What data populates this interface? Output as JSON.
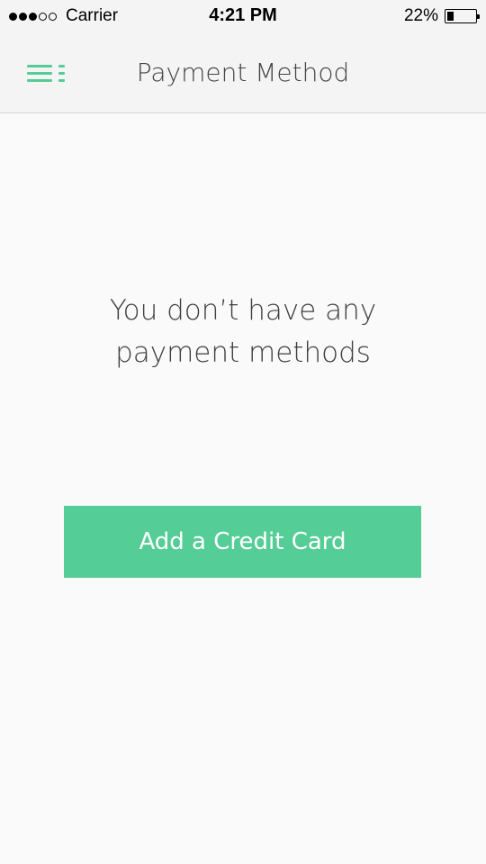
{
  "status_bar": {
    "carrier": "Carrier",
    "time": "4:21 PM",
    "battery_percent": "22%",
    "battery_level": 0.22,
    "signal_bars_filled": 3,
    "signal_bars_total": 5
  },
  "nav": {
    "title": "Payment Method",
    "menu_icon": "menu-icon"
  },
  "main": {
    "empty_line1": "You don’t have any",
    "empty_line2": "payment methods",
    "add_card_label": "Add a Credit Card"
  },
  "colors": {
    "accent": "#55cd97",
    "background": "#fafafa",
    "nav_background": "#f4f4f4"
  }
}
